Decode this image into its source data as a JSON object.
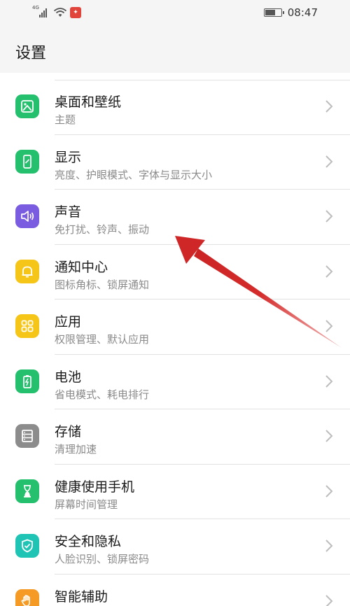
{
  "status_bar": {
    "network": "4G",
    "time": "08:47",
    "battery_level": 0.7
  },
  "header": {
    "title": "设置"
  },
  "settings": [
    {
      "title": "桌面和壁纸",
      "subtitle": "主题",
      "icon": "wallpaper-icon",
      "color": "#25c06e"
    },
    {
      "title": "显示",
      "subtitle": "亮度、护眼模式、字体与显示大小",
      "icon": "phone-display-icon",
      "color": "#25c06e"
    },
    {
      "title": "声音",
      "subtitle": "免打扰、铃声、振动",
      "icon": "speaker-icon",
      "color": "#7a5ce0"
    },
    {
      "title": "通知中心",
      "subtitle": "图标角标、锁屏通知",
      "icon": "bell-icon",
      "color": "#f5c518"
    },
    {
      "title": "应用",
      "subtitle": "权限管理、默认应用",
      "icon": "apps-grid-icon",
      "color": "#f5c518"
    },
    {
      "title": "电池",
      "subtitle": "省电模式、耗电排行",
      "icon": "battery-icon",
      "color": "#25c06e"
    },
    {
      "title": "存储",
      "subtitle": "清理加速",
      "icon": "storage-icon",
      "color": "#8c8c8c"
    },
    {
      "title": "健康使用手机",
      "subtitle": "屏幕时间管理",
      "icon": "hourglass-icon",
      "color": "#25c06e"
    },
    {
      "title": "安全和隐私",
      "subtitle": "人脸识别、锁屏密码",
      "icon": "shield-icon",
      "color": "#1fc4b4"
    },
    {
      "title": "智能辅助",
      "subtitle": "",
      "icon": "hand-icon",
      "color": "#f59a24"
    }
  ],
  "annotation": {
    "arrow_color": "#d42b2b"
  }
}
